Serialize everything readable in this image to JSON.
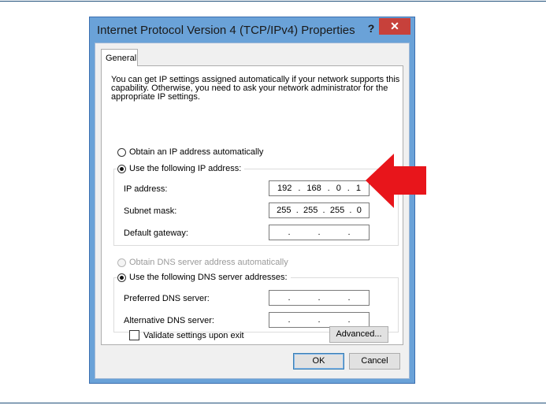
{
  "dialog": {
    "title": "Internet Protocol Version 4 (TCP/IPv4) Properties",
    "help_label": "?",
    "close_label": "✕",
    "tab_label": "General",
    "description": "You can get IP settings assigned automatically if your network supports this capability. Otherwise, you need to ask your network administrator for the appropriate IP settings."
  },
  "ip_section": {
    "obtain_auto_label": "Obtain an IP address automatically",
    "obtain_auto_selected": false,
    "use_following_label": "Use the following IP address:",
    "use_following_selected": true,
    "fields": [
      {
        "label": "IP address:",
        "octets": [
          "192",
          "168",
          "0",
          "1"
        ]
      },
      {
        "label": "Subnet mask:",
        "octets": [
          "255",
          "255",
          "255",
          "0"
        ]
      },
      {
        "label": "Default gateway:",
        "octets": [
          "",
          "",
          "",
          ""
        ]
      }
    ]
  },
  "dns_section": {
    "obtain_auto_label": "Obtain DNS server address automatically",
    "obtain_auto_selected": false,
    "obtain_auto_disabled": true,
    "use_following_label": "Use the following DNS server addresses:",
    "use_following_selected": true,
    "fields": [
      {
        "label": "Preferred DNS server:",
        "octets": [
          "",
          "",
          "",
          ""
        ]
      },
      {
        "label": "Alternative DNS server:",
        "octets": [
          "",
          "",
          "",
          ""
        ]
      }
    ]
  },
  "validate_label": "Validate settings upon exit",
  "validate_checked": false,
  "buttons": {
    "advanced": "Advanced...",
    "ok": "OK",
    "cancel": "Cancel"
  },
  "colors": {
    "title_bar": "#6aa2d8",
    "close_button": "#c7413b",
    "arrow": "#e8151b"
  }
}
